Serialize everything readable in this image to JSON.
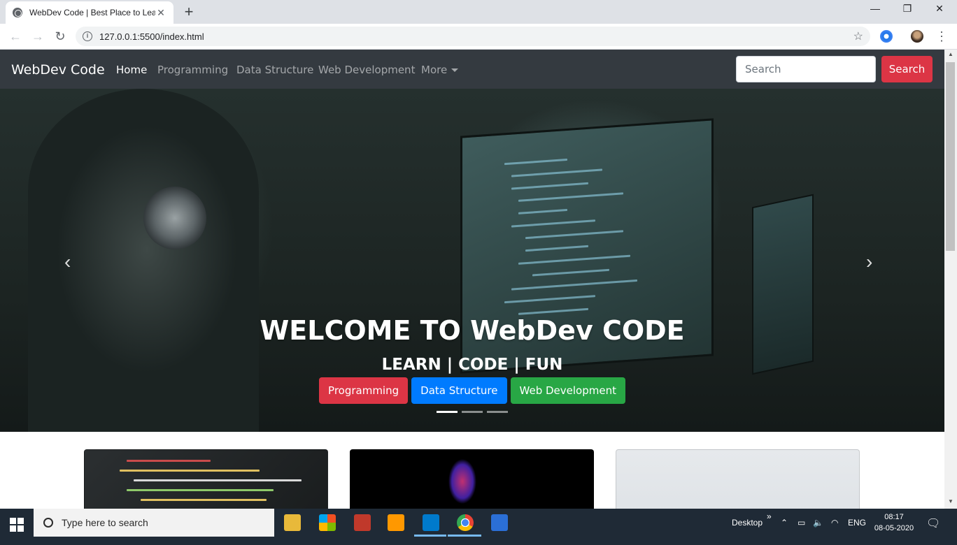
{
  "browser": {
    "tab_title": "WebDev Code | Best Place to Lea",
    "url": "127.0.0.1:5500/index.html",
    "new_tab": "+",
    "close_tab": "✕",
    "minimize": "—",
    "restore": "❐",
    "close_window": "✕"
  },
  "navbar": {
    "brand": "WebDev Code",
    "links": [
      "Home",
      "Programming",
      "Data Structure",
      "Web Development",
      "More"
    ],
    "active": "Home",
    "search_placeholder": "Search",
    "search_button": "Search"
  },
  "carousel": {
    "heading": "WELCOME TO WebDev CODE",
    "subheading": "LEARN | CODE | FUN",
    "buttons": [
      {
        "label": "Programming",
        "color": "#dc3545"
      },
      {
        "label": "Data Structure",
        "color": "#007bff"
      },
      {
        "label": "Web Development",
        "color": "#28a745"
      }
    ],
    "prev_icon": "chevron-left-icon",
    "next_icon": "chevron-right-icon",
    "slides_total": 3,
    "active_slide": 1
  },
  "taskbar": {
    "search_placeholder": "Type here to search",
    "desktop_label": "Desktop",
    "language": "ENG",
    "time": "08:17",
    "date": "08-05-2020"
  },
  "colors": {
    "navbar_bg": "#343a40",
    "danger": "#dc3545",
    "primary": "#007bff",
    "success": "#28a745"
  }
}
